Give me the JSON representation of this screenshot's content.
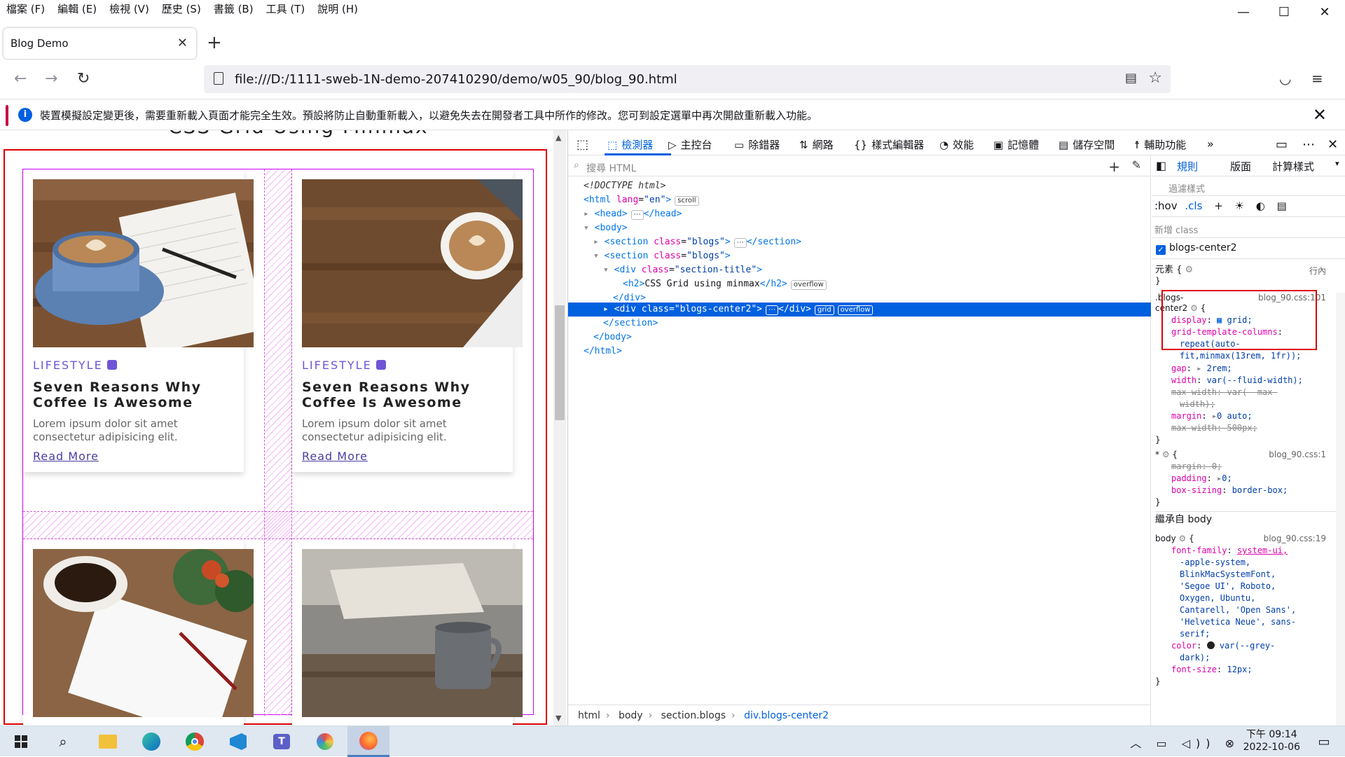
{
  "menubar": {
    "items": [
      "檔案 (F)",
      "編輯 (E)",
      "檢視 (V)",
      "歷史 (S)",
      "書籤 (B)",
      "工具 (T)",
      "說明 (H)"
    ]
  },
  "window": {
    "minimize": "—",
    "maximize": "☐",
    "close": "✕"
  },
  "tab": {
    "title": "Blog Demo",
    "close": "✕",
    "new": "+"
  },
  "toolbar": {
    "back": "←",
    "forward": "→",
    "reload": "↻",
    "url": "file:///D:/1111-sweb-1N-demo-207410290/demo/w05_90/blog_90.html"
  },
  "notification": {
    "text": "裝置模擬設定變更後，需要重新載入頁面才能完全生效。預設將防止自動重新載入，以避免失去在開發者工具中所作的修改。您可到設定選單中再次開啟重新載入功能。",
    "close": "✕"
  },
  "page": {
    "title": "CSS Grid Using Minmax",
    "cards": [
      {
        "category": "LIFESTYLE",
        "title": "Seven Reasons Why Coffee Is Awesome",
        "desc": "Lorem ipsum dolor sit amet consectetur adipisicing elit.",
        "link": "Read More"
      },
      {
        "category": "LIFESTYLE",
        "title": "Seven Reasons Why Coffee Is Awesome",
        "desc": "Lorem ipsum dolor sit amet consectetur adipisicing elit.",
        "link": "Read More"
      }
    ]
  },
  "devtools": {
    "tabs": [
      "檢測器",
      "主控台",
      "除錯器",
      "網路",
      "樣式編輯器",
      "效能",
      "記憶體",
      "儲存空間",
      "輔助功能"
    ],
    "search_placeholder": "搜尋 HTML",
    "tree": {
      "doctype": "<!DOCTYPE html>",
      "html_open_tag": "<html",
      "lang_attr": "lang",
      "lang_val": "\"en\"",
      "scroll_badge": "scroll",
      "head": "<head>",
      "head_close": "</head>",
      "body": "<body>",
      "section_tag": "<section",
      "class_attr": "class",
      "blogs_val": "\"blogs\"",
      "section_close": "</section>",
      "div_tag": "<div",
      "section_title_val": "\"section-title\"",
      "h2_open": "<h2>",
      "h2_text": "CSS Grid using minmax",
      "h2_close": "</h2>",
      "overflow_badge": "overflow",
      "div_close": "</div>",
      "blogs_center_val": "\"blogs-center2\"",
      "grid_badge": "grid",
      "body_close": "</body>",
      "html_close": "</html>",
      "ellipsis": "⋯"
    },
    "breadcrumbs": [
      "html",
      "body",
      "section.blogs",
      "div.blogs-center2"
    ],
    "rules_tabs": [
      "規則",
      "版面",
      "計算樣式"
    ],
    "filter_placeholder": "過濾樣式",
    "pseudo_buttons": [
      ":hov",
      ".cls"
    ],
    "new_class_placeholder": "新增 class",
    "class_checkbox": "blogs-center2",
    "element_rule": {
      "selector": "元素 {",
      "inline": "行內",
      "close": "}"
    },
    "rule1": {
      "selector_a": ".blogs-",
      "selector_b": "center2",
      "source": "blog_90.css:101",
      "decls": [
        {
          "p": "display",
          "v": "grid;"
        },
        {
          "p": "grid-template-columns",
          "v": ""
        },
        {
          "p": "",
          "v": "repeat(auto-"
        },
        {
          "p": "",
          "v": "fit,minmax(13rem, 1fr));"
        },
        {
          "p": "gap",
          "v": "2rem;"
        },
        {
          "p": "width",
          "v": "var(--fluid-width);"
        },
        {
          "p": "max-width",
          "v": "var(--max-"
        },
        {
          "p": "",
          "v": "width);"
        },
        {
          "p": "margin",
          "v": "0 auto;"
        },
        {
          "p": "max-width",
          "v": "500px;"
        }
      ]
    },
    "rule2": {
      "selector": "* ",
      "source": "blog_90.css:1",
      "decls": [
        {
          "p": "margin",
          "v": "0;"
        },
        {
          "p": "padding",
          "v": "0;"
        },
        {
          "p": "box-sizing",
          "v": "border-box;"
        }
      ]
    },
    "inherited": "繼承自 body",
    "rule3": {
      "selector": "body ",
      "source": "blog_90.css:19",
      "decls": [
        {
          "p": "font-family",
          "v": "system-ui,"
        },
        {
          "p": "",
          "v": "-apple-system,"
        },
        {
          "p": "",
          "v": "BlinkMacSystemFont,"
        },
        {
          "p": "",
          "v": "'Segoe UI', Roboto,"
        },
        {
          "p": "",
          "v": "Oxygen, Ubuntu,"
        },
        {
          "p": "",
          "v": "Cantarell, 'Open Sans',"
        },
        {
          "p": "",
          "v": "'Helvetica Neue', sans-"
        },
        {
          "p": "",
          "v": "serif;"
        },
        {
          "p": "color",
          "v": "var(--grey-"
        },
        {
          "p": "",
          "v": "dark);"
        },
        {
          "p": "font-size",
          "v": "12px;"
        }
      ]
    }
  },
  "taskbar": {
    "time": "下午 09:14",
    "date": "2022-10-06"
  }
}
